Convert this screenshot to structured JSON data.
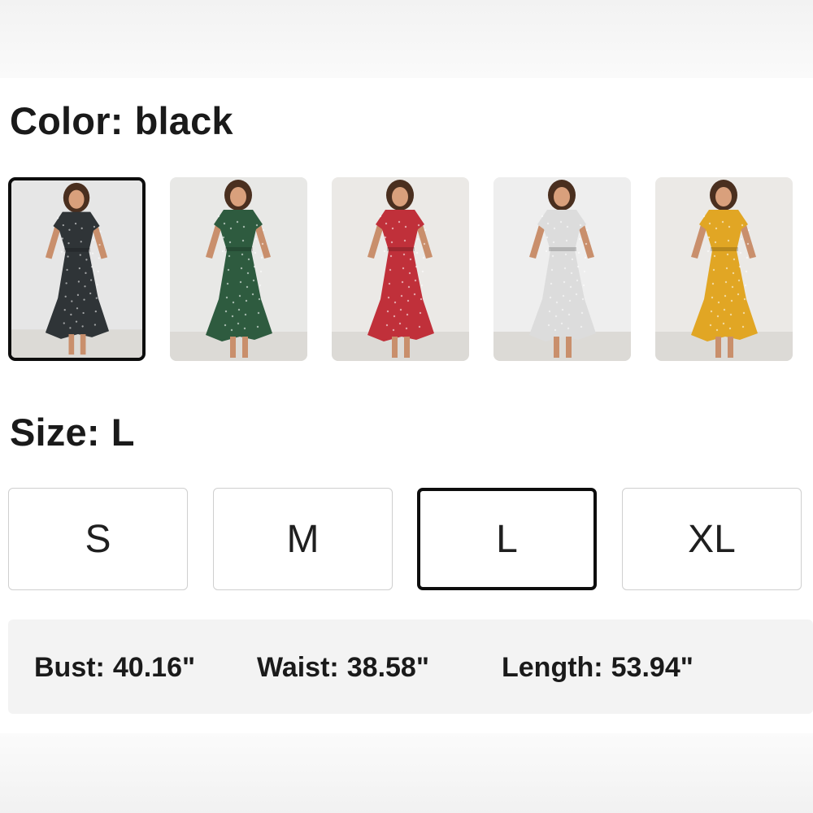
{
  "color": {
    "label": "Color:",
    "value": "black",
    "swatches": [
      {
        "icon": "dress-photo-black",
        "dress_color": "#2f3437",
        "bg_color": "#e6e6e6",
        "selected": true
      },
      {
        "icon": "dress-photo-green",
        "dress_color": "#2e5b3f",
        "bg_color": "#e8e8e6",
        "selected": false
      },
      {
        "icon": "dress-photo-red",
        "dress_color": "#c0303a",
        "bg_color": "#ebe9e6",
        "selected": false
      },
      {
        "icon": "dress-photo-white",
        "dress_color": "#dcdcdc",
        "bg_color": "#eeeeee",
        "selected": false
      },
      {
        "icon": "dress-photo-yellow",
        "dress_color": "#e1a624",
        "bg_color": "#ebe9e6",
        "selected": false
      }
    ]
  },
  "size": {
    "label": "Size:",
    "value": "L",
    "options": [
      {
        "label": "S",
        "selected": false
      },
      {
        "label": "M",
        "selected": false
      },
      {
        "label": "L",
        "selected": true
      },
      {
        "label": "XL",
        "selected": false
      }
    ]
  },
  "measurements": [
    {
      "label": "Bust:",
      "value": "40.16\""
    },
    {
      "label": "Waist:",
      "value": "38.58\""
    },
    {
      "label": "Length:",
      "value": "53.94\""
    }
  ],
  "colors": {
    "selected_border": "#0d0d0d",
    "button_border": "#cfcfcf",
    "measure_bg": "#f3f3f3",
    "text": "#1a1a1a"
  }
}
